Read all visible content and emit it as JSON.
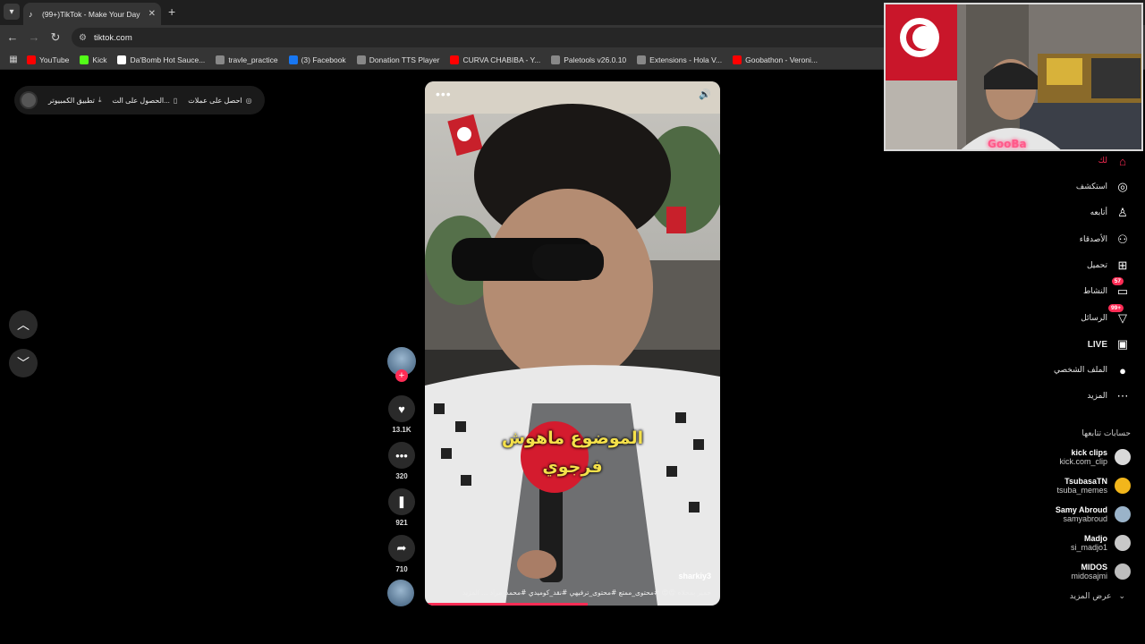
{
  "browser": {
    "tab_title": "(99+)TikTok - Make Your Day",
    "url": "tiktok.com",
    "bookmarks": [
      {
        "label": "YouTube",
        "icon": "youtube-icon",
        "color": "#ff0000"
      },
      {
        "label": "Kick",
        "icon": "kick-icon",
        "color": "#53fc18"
      },
      {
        "label": "Da'Bomb Hot Sauce...",
        "icon": "page-icon",
        "color": "#ffffff"
      },
      {
        "label": "travle_practice",
        "icon": "globe-icon",
        "color": "#888888"
      },
      {
        "label": "(3) Facebook",
        "icon": "facebook-icon",
        "color": "#1877f2"
      },
      {
        "label": "Donation TTS Player",
        "icon": "globe-icon",
        "color": "#888888"
      },
      {
        "label": "CURVA CHABIBA - Y...",
        "icon": "youtube-icon",
        "color": "#ff0000"
      },
      {
        "label": "Paletools v26.0.10",
        "icon": "globe-icon",
        "color": "#888888"
      },
      {
        "label": "Extensions - Hola V...",
        "icon": "puzzle-icon",
        "color": "#888888"
      },
      {
        "label": "Goobathon - Veroni...",
        "icon": "youtube-icon",
        "color": "#ff0000"
      }
    ]
  },
  "top_bar": {
    "desktop_app": "تطبيق الكمبيوتر",
    "get_on": "الحصول على الت...",
    "get_coins": "احصل على عملات"
  },
  "video": {
    "caption_line1": "الموضوع ماهوش",
    "caption_line2": "فرجوي",
    "username": "sharkiy3",
    "description": "حمير بمحلاه 😍😍 #محتوى_ممتع #محتوى_ترفيهي #نقد_كوميدي #محمد_مراد ... المزيد",
    "progress": 0.55
  },
  "actions": {
    "likes": "13.1K",
    "comments": "320",
    "saves": "921",
    "shares": "710"
  },
  "sidebar": {
    "items": [
      {
        "label": "لك",
        "icon": "home-icon",
        "active": true
      },
      {
        "label": "استكشف",
        "icon": "compass-icon"
      },
      {
        "label": "أتابعه",
        "icon": "following-icon"
      },
      {
        "label": "الأصدقاء",
        "icon": "friends-icon"
      },
      {
        "label": "تحميل",
        "icon": "upload-icon"
      },
      {
        "label": "النشاط",
        "icon": "activity-icon",
        "badge": "57"
      },
      {
        "label": "الرسائل",
        "icon": "messages-icon",
        "badge": "+99"
      },
      {
        "label": "LIVE",
        "icon": "live-icon"
      },
      {
        "label": "الملف الشخصي",
        "icon": "profile-icon"
      },
      {
        "label": "المزيد",
        "icon": "more-icon"
      }
    ],
    "following_title": "حسابات تتابعها",
    "following": [
      {
        "name": "kick clips",
        "handle": "kick.com_clip"
      },
      {
        "name": "TsubasaTN",
        "handle": "tsuba_memes"
      },
      {
        "name": "Samy Abroud",
        "handle": "samyabroud"
      },
      {
        "name": "Madjo",
        "handle": "si_madjo1"
      },
      {
        "name": "MIDOS",
        "handle": "midosajmi"
      }
    ],
    "see_more": "عرض المزيد"
  },
  "webcam": {
    "tag": "GooBa"
  }
}
